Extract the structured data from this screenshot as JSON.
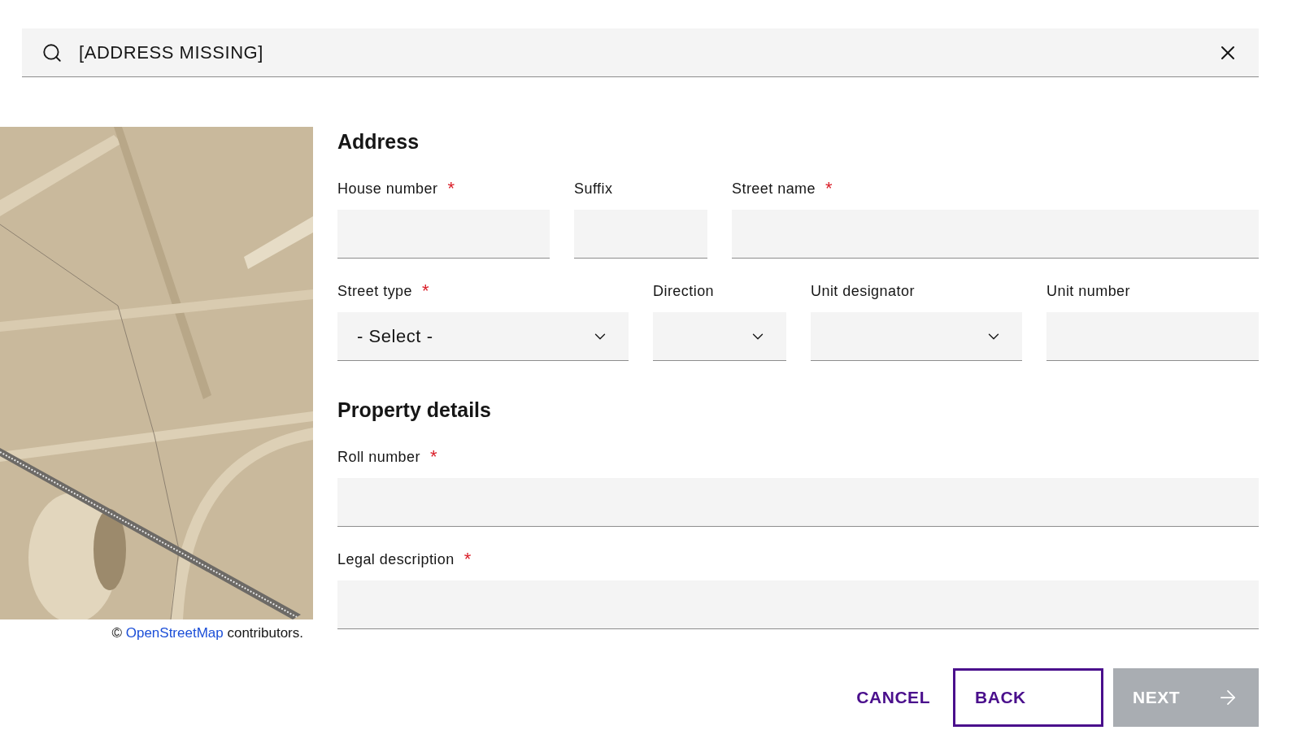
{
  "search": {
    "value": "[ADDRESS MISSING]"
  },
  "map": {
    "kind": "picture",
    "attribution": {
      "prefix": "©",
      "link": "OpenStreetMap",
      "suffix": "contributors."
    }
  },
  "required_mark": "*",
  "sections": [
    {
      "title": "Address",
      "rows": [
        [
          {
            "label": "House number",
            "required": true,
            "kind": "text"
          },
          {
            "label": "Suffix",
            "required": false,
            "kind": "text"
          },
          {
            "label": "Street name",
            "required": true,
            "kind": "text"
          }
        ],
        [
          {
            "label": "Street type",
            "required": true,
            "kind": "select",
            "value": "- Select -"
          },
          {
            "label": "Direction",
            "required": false,
            "kind": "select"
          },
          {
            "label": "Unit designator",
            "required": false,
            "kind": "select"
          },
          {
            "label": "Unit number",
            "required": false,
            "kind": "text"
          }
        ]
      ]
    },
    {
      "title": "Property details",
      "rows": [
        [
          {
            "label": "Roll number",
            "required": true,
            "kind": "text"
          }
        ],
        [
          {
            "label": "Legal description",
            "required": true,
            "kind": "text"
          }
        ]
      ]
    }
  ],
  "buttons": [
    {
      "label": "CANCEL",
      "kind": "link",
      "disabled": false
    },
    {
      "label": "BACK",
      "kind": "outline",
      "disabled": false
    },
    {
      "label": "NEXT",
      "kind": "primary",
      "disabled": true
    }
  ]
}
